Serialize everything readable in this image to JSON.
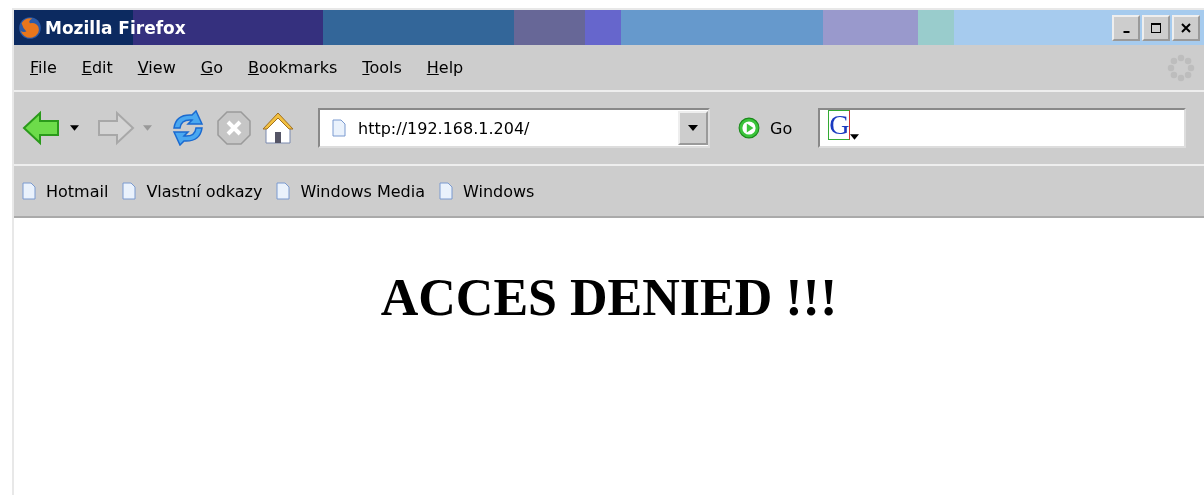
{
  "window": {
    "title": "Mozilla Firefox"
  },
  "menu": [
    {
      "label": "File"
    },
    {
      "label": "Edit"
    },
    {
      "label": "View"
    },
    {
      "label": "Go"
    },
    {
      "label": "Bookmarks"
    },
    {
      "label": "Tools"
    },
    {
      "label": "Help"
    }
  ],
  "toolbar": {
    "buttons": [
      {
        "kind": "back",
        "disabled": false
      },
      {
        "kind": "forward",
        "disabled": true
      },
      {
        "kind": "reload",
        "disabled": false
      },
      {
        "kind": "stop",
        "disabled": true
      },
      {
        "kind": "home",
        "disabled": false
      }
    ],
    "address": {
      "value": "http://192.168.1.204/"
    },
    "go_label": "Go",
    "search": {
      "engine_glyph": "G"
    }
  },
  "bookmarks": [
    {
      "label": "Hotmail"
    },
    {
      "label": "Vlastní odkazy"
    },
    {
      "label": "Windows Media"
    },
    {
      "label": "Windows"
    }
  ],
  "page": {
    "heading": "ACCES DENIED !!!"
  }
}
